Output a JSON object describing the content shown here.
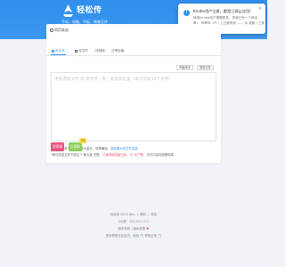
{
  "header": {
    "brand": "轻松传",
    "tagline": "手机、电脑、平板、跨端互传"
  },
  "popup": {
    "title": "Kindle用户注意，都是已停止应用!",
    "line1": "使用Kindle用户需要登录，快速已有一个新设",
    "line2": "备)，查看到（在 / 上已被有效 —— 待 更新 / 之类"
  },
  "breadcrumb": {
    "label": "同页发送"
  },
  "tabs": [
    {
      "label": "传文字",
      "active": true
    },
    {
      "label": "传文件",
      "active": false
    },
    {
      "label": "传相册",
      "active": false
    },
    {
      "label": "分享页面",
      "active": false
    }
  ],
  "actions": {
    "text_button": "不能传字",
    "file_button": "发送文件"
  },
  "textarea": {
    "placeholder": "点击添加文件 或 将文件（夹）拖放到这里（单次可发10个文件）"
  },
  "notes": {
    "line1_a": "*发送文件单个大小 5 最大量无，请按确选，",
    "line1_b": "选择最大的文件发送",
    "line2_a": "*单次发送文件不超过 5 最大量 无限，",
    "line2_b": "已读消息结束日后：10 天下载，",
    "line2_c": "文件内容将被删除掉"
  },
  "buttons": {
    "ai_label": "消息帮",
    "generate_label": "立即取",
    "badge": "3天"
  },
  "footer": {
    "line1": "轻松传 2023 Abu 丨 帮助 丨 联系",
    "line2": "QQ群：161-571-371",
    "line3": "服务条款丨隐私政策",
    "line4": "更多帮助在社区内，使用 📋 帮助反馈 📋",
    "heart": "♥"
  }
}
